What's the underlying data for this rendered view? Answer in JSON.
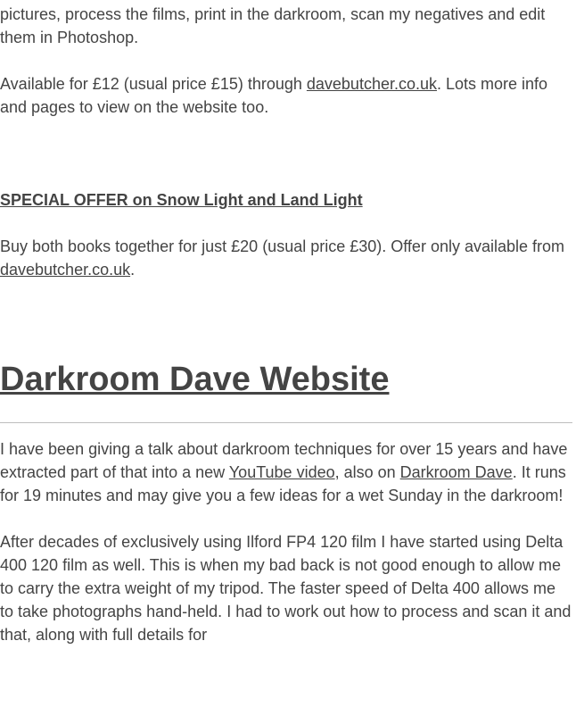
{
  "intro": {
    "para1": "pictures, process the films, print in the darkroom, scan my negatives and edit them in Photoshop.",
    "para2_before": "Available for £12 (usual price £15) through ",
    "para2_link": "davebutcher.co.uk",
    "para2_after": ". Lots more info and pages to view on the website too."
  },
  "offer": {
    "heading": "SPECIAL OFFER on Snow Light and Land Light",
    "text_before": "Buy both books together for just £20 (usual price £30). Offer only available from ",
    "link": "davebutcher.co.uk",
    "text_after": "."
  },
  "website": {
    "heading": "Darkroom Dave Website",
    "para1_a": "I have been giving a talk about darkroom techniques for over 15 years and have extracted part of that into a new ",
    "para1_link1": "YouTube video",
    "para1_b": ", also on ",
    "para1_link2": "Darkroom Dave",
    "para1_c": ". It runs for 19 minutes and may give you a few ideas for a wet Sunday in the darkroom!",
    "para2": "After decades of exclusively using Ilford FP4 120 film I have started using Delta 400 120 film as well. This is when my bad back is not good enough to allow me to carry the extra weight of my tripod. The faster speed of Delta 400 allows me to take photographs hand-held. I had to work out how to process and scan it and that, along with full details for"
  }
}
